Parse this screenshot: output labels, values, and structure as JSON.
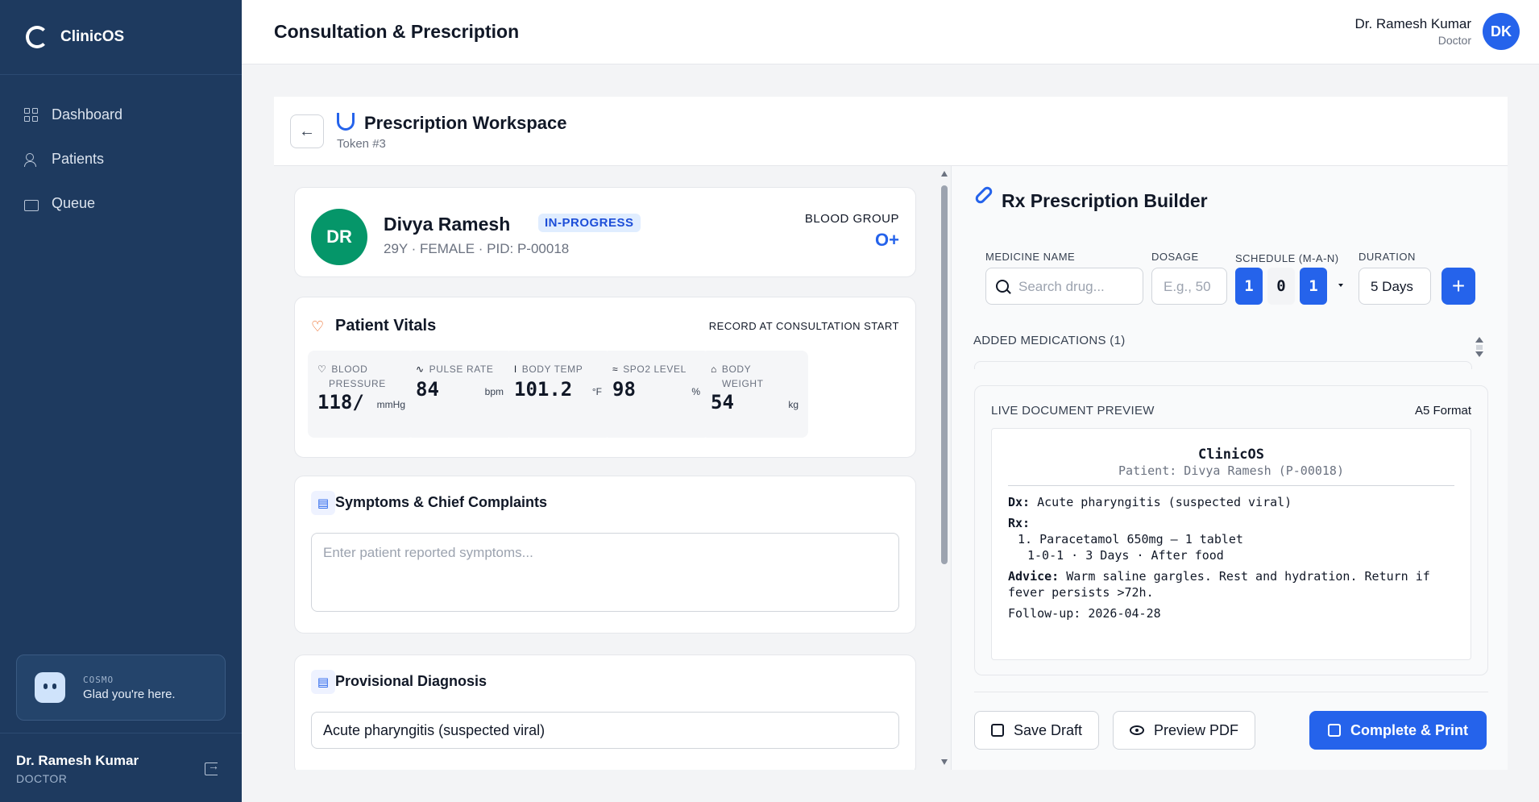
{
  "brand": {
    "name": "ClinicOS"
  },
  "nav": [
    {
      "label": "Dashboard",
      "icon": "grid-icon"
    },
    {
      "label": "Patients",
      "icon": "users-icon"
    },
    {
      "label": "Queue",
      "icon": "ticket-icon"
    }
  ],
  "cosmo": {
    "label": "COSMO",
    "message": "Glad you're here."
  },
  "sidebar_user": {
    "name": "Dr. Ramesh Kumar",
    "role": "DOCTOR"
  },
  "header": {
    "title": "Consultation & Prescription",
    "user_name": "Dr. Ramesh Kumar",
    "user_role": "Doctor",
    "initials": "DK"
  },
  "workspace": {
    "title": "Prescription Workspace",
    "token": "Token #3"
  },
  "patient": {
    "initials": "DR",
    "name": "Divya Ramesh",
    "status": "IN-PROGRESS",
    "meta": "29Y · FEMALE · PID: P-00018",
    "blood_group_label": "BLOOD GROUP",
    "blood_group": "O+"
  },
  "vitals": {
    "title": "Patient Vitals",
    "subtitle": "RECORD AT CONSULTATION START",
    "items": [
      {
        "label_line1": "BLOOD",
        "label_line2": "PRESSURE",
        "value": "118/",
        "unit": "mmHg",
        "icon": "heart-icon"
      },
      {
        "label_line1": "PULSE RATE",
        "label_line2": "",
        "value": "84",
        "unit": "bpm",
        "icon": "pulse-icon"
      },
      {
        "label_line1": "BODY TEMP",
        "label_line2": "",
        "value": "101.2",
        "unit": "°F",
        "icon": "thermometer-icon"
      },
      {
        "label_line1": "SPO2 LEVEL",
        "label_line2": "",
        "value": "98",
        "unit": "%",
        "icon": "wind-icon"
      },
      {
        "label_line1": "BODY",
        "label_line2": "WEIGHT",
        "value": "54",
        "unit": "kg",
        "icon": "weight-icon"
      }
    ]
  },
  "symptoms": {
    "title": "Symptoms & Chief Complaints",
    "placeholder": "Enter patient reported symptoms..."
  },
  "diagnosis": {
    "title": "Provisional Diagnosis",
    "value": "Acute pharyngitis (suspected viral)"
  },
  "rx": {
    "title": "Rx Prescription Builder",
    "medicine_label": "MEDICINE NAME",
    "medicine_placeholder": "Search drug...",
    "dosage_label": "DOSAGE",
    "dosage_placeholder": "E.g., 50",
    "schedule_label": "SCHEDULE (M-A-N)",
    "schedule": [
      "1",
      "0",
      "1"
    ],
    "duration_label": "DURATION",
    "duration": "5 Days",
    "added_label": "ADDED MEDICATIONS (1)"
  },
  "preview": {
    "label": "LIVE DOCUMENT PREVIEW",
    "format": "A5 Format",
    "brand": "ClinicOS",
    "patient_line": "Patient: Divya Ramesh (P-00018)",
    "dx_label": "Dx:",
    "dx_value": "Acute pharyngitis (suspected viral)",
    "rx_label": "Rx:",
    "med_line": "1. Paracetamol 650mg — 1 tablet",
    "med_detail": "1-0-1 · 3 Days · After food",
    "advice_label": "Advice:",
    "advice_value": "Warm saline gargles. Rest and hydration. Return if",
    "advice_value2": "fever persists >72h.",
    "followup": "Follow-up: 2026-04-28"
  },
  "actions": {
    "save_draft": "Save Draft",
    "preview_pdf": "Preview PDF",
    "complete_print": "Complete & Print"
  },
  "colors": {
    "sidebar": "#1e3a5f",
    "primary": "#2563eb",
    "avatar_green": "#059669"
  }
}
